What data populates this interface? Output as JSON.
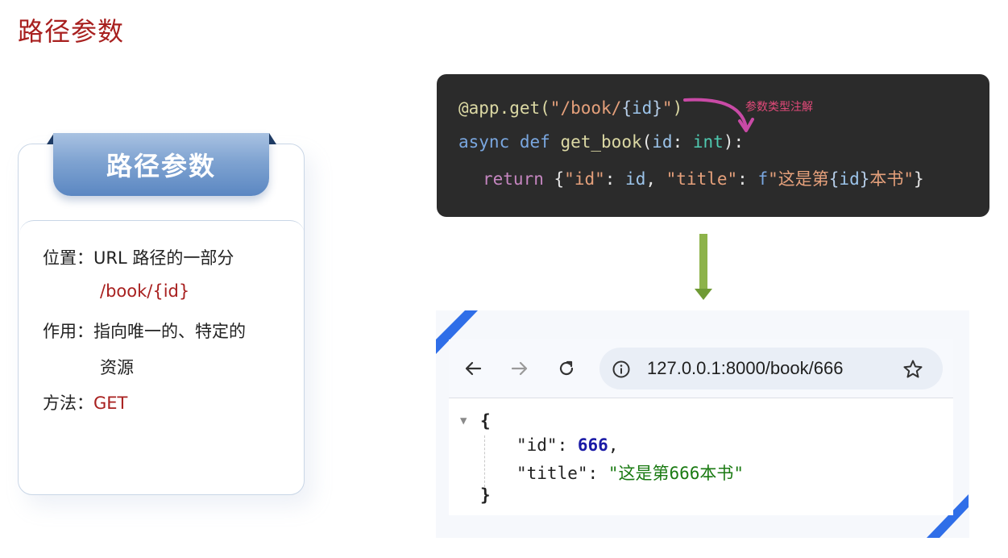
{
  "page_title": "路径参数",
  "card": {
    "heading": "路径参数",
    "position_label": "位置：",
    "position_value": "URL 路径的一部分",
    "position_example": "/book/{id}",
    "purpose_label": "作用：",
    "purpose_value_1": "指向唯一的、特定的",
    "purpose_value_2": "资源",
    "method_label": "方法：",
    "method_value": "GET"
  },
  "code": {
    "line1": {
      "decorator": "@app.get(",
      "path_str": "\"/book/",
      "brace_open": "{",
      "param": "id",
      "brace_close": "}",
      "path_end": "\"",
      "close": ")"
    },
    "line2": {
      "kw_async": "async",
      "kw_def": "def",
      "fn": "get_book",
      "open": "(",
      "param": "id",
      "colon": ": ",
      "type": "int",
      "close": "):"
    },
    "line3": {
      "kw_return": "return",
      "open": "{",
      "key_id": "\"id\"",
      "colon1": ": ",
      "val_id": "id",
      "comma": ", ",
      "key_title": "\"title\"",
      "colon2": ": ",
      "fprefix": "f",
      "str_a": "\"这是第",
      "brace_open": "{",
      "expr": "id",
      "brace_close": "}",
      "str_b": "本书\"",
      "close": "}"
    },
    "annotation": "参数类型注解"
  },
  "browser": {
    "url": "127.0.0.1:8000/book/666",
    "back_icon": "arrow-left-icon",
    "forward_icon": "arrow-right-icon",
    "reload_icon": "reload-icon",
    "info_icon": "info-icon",
    "star_icon": "star-icon"
  },
  "json_response": {
    "toggle": "▼",
    "open": "{",
    "key_id": "\"id\"",
    "val_id": "666",
    "key_title": "\"title\"",
    "val_title": "\"这是第666本书\"",
    "close": "}"
  },
  "colors": {
    "title_red": "#a8201f",
    "code_bg": "#2b2b2b",
    "arrow_green": "#8db34a",
    "corner_blue": "#2f6ee8",
    "annotation_pink": "#e24a7a"
  }
}
